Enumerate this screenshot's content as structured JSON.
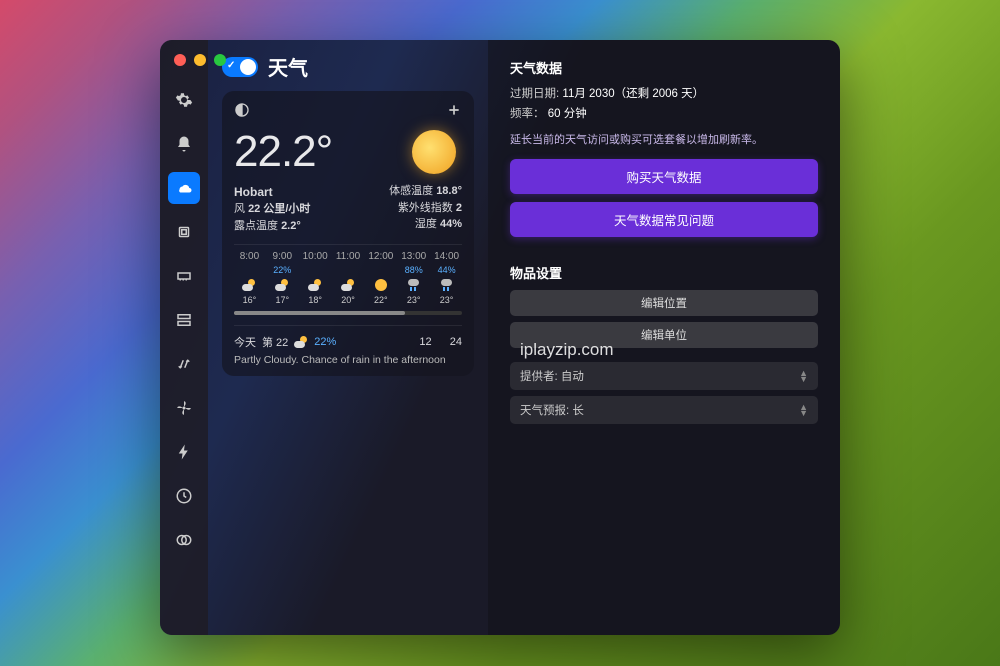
{
  "header": {
    "title": "天气"
  },
  "watermark": "iplayzip.com",
  "weather": {
    "temp": "22.2°",
    "city": "Hobart",
    "wind_label": "风",
    "wind_value": "22 公里/小时",
    "dew_label": "露点温度",
    "dew_value": "2.2°",
    "feels_label": "体感温度",
    "feels_value": "18.8°",
    "uv_label": "紫外线指数",
    "uv_value": "2",
    "humidity_label": "湿度",
    "humidity_value": "44%"
  },
  "hourly": [
    {
      "time": "8:00",
      "precip": "",
      "icon": "cloud-sun",
      "temp": "16°"
    },
    {
      "time": "9:00",
      "precip": "22%",
      "icon": "cloud-sun",
      "temp": "17°"
    },
    {
      "time": "10:00",
      "precip": "",
      "icon": "cloud-sun",
      "temp": "18°"
    },
    {
      "time": "11:00",
      "precip": "",
      "icon": "cloud-sun",
      "temp": "20°"
    },
    {
      "time": "12:00",
      "precip": "",
      "icon": "sun",
      "temp": "22°"
    },
    {
      "time": "13:00",
      "precip": "88%",
      "icon": "rain",
      "temp": "23°"
    },
    {
      "time": "14:00",
      "precip": "44%",
      "icon": "rain",
      "temp": "23°"
    }
  ],
  "today": {
    "label": "今天",
    "cond": "第 22",
    "precip": "22%",
    "low": "12",
    "high": "24",
    "desc": "Partly Cloudy. Chance of rain in the afternoon"
  },
  "right": {
    "data_title": "天气数据",
    "expiry_label": "过期日期:",
    "expiry_value": "11月 2030（还剩 2006 天）",
    "freq_label": "频率：",
    "freq_value": "60 分钟",
    "note": "延长当前的天气访问或购买可选套餐以增加刷新率。",
    "buy_btn": "购买天气数据",
    "faq_btn": "天气数据常见问题",
    "item_title": "物品设置",
    "edit_loc": "编辑位置",
    "edit_unit": "编辑单位",
    "provider_label": "提供者:",
    "provider_value": "自动",
    "forecast_label": "天气预报:",
    "forecast_value": "长"
  }
}
